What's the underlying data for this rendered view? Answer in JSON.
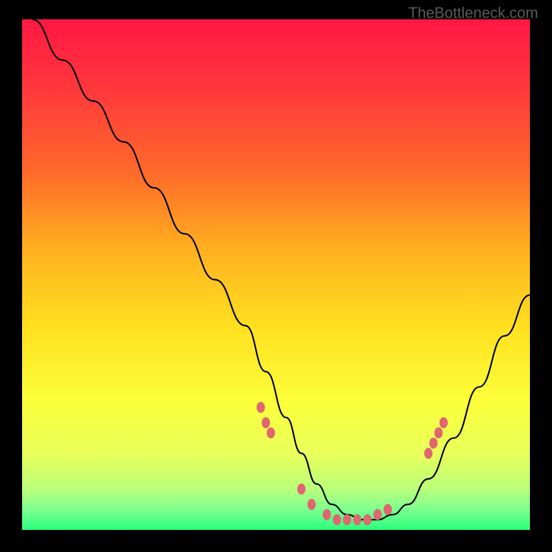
{
  "watermark": "TheBottleneck.com",
  "chart_data": {
    "type": "line",
    "title": "",
    "xlabel": "",
    "ylabel": "",
    "xlim": [
      0,
      100
    ],
    "ylim": [
      0,
      100
    ],
    "gradient_stops": [
      {
        "offset": 0,
        "color": "#ff1744"
      },
      {
        "offset": 15,
        "color": "#ff3b3b"
      },
      {
        "offset": 30,
        "color": "#ff6a2a"
      },
      {
        "offset": 45,
        "color": "#ffb01f"
      },
      {
        "offset": 60,
        "color": "#ffe01f"
      },
      {
        "offset": 75,
        "color": "#fcff3a"
      },
      {
        "offset": 85,
        "color": "#e8ff5a"
      },
      {
        "offset": 92,
        "color": "#baff7a"
      },
      {
        "offset": 96,
        "color": "#7dff8f"
      },
      {
        "offset": 100,
        "color": "#2bff7e"
      }
    ],
    "series": [
      {
        "name": "bottleneck-curve",
        "x": [
          2,
          8,
          14,
          20,
          26,
          32,
          38,
          44,
          48,
          52,
          55,
          58,
          61,
          64,
          67,
          70,
          73,
          76,
          80,
          85,
          90,
          95,
          100
        ],
        "y": [
          100,
          92,
          84,
          76,
          67,
          58,
          49,
          40,
          31,
          22,
          15,
          9,
          5,
          3,
          2,
          2,
          3,
          5,
          10,
          18,
          28,
          38,
          46
        ]
      }
    ],
    "markers": {
      "name": "highlight-points",
      "color": "#e06670",
      "points": [
        {
          "x": 47,
          "y": 24
        },
        {
          "x": 48,
          "y": 21
        },
        {
          "x": 49,
          "y": 19
        },
        {
          "x": 55,
          "y": 8
        },
        {
          "x": 57,
          "y": 5
        },
        {
          "x": 60,
          "y": 3
        },
        {
          "x": 62,
          "y": 2
        },
        {
          "x": 64,
          "y": 2
        },
        {
          "x": 66,
          "y": 2
        },
        {
          "x": 68,
          "y": 2
        },
        {
          "x": 70,
          "y": 3
        },
        {
          "x": 72,
          "y": 4
        },
        {
          "x": 80,
          "y": 15
        },
        {
          "x": 81,
          "y": 17
        },
        {
          "x": 82,
          "y": 19
        },
        {
          "x": 83,
          "y": 21
        }
      ]
    }
  }
}
